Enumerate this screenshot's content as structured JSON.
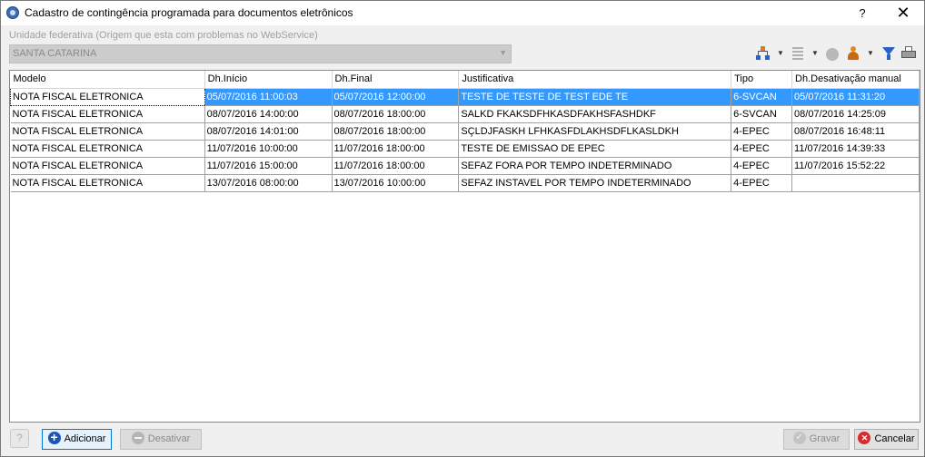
{
  "window": {
    "title": "Cadastro de contingência programada para documentos eletrônicos",
    "help_glyph": "?",
    "close_glyph": "✕"
  },
  "filter": {
    "label": "Unidade federativa (Origem que esta com problemas no WebService)",
    "value": "SANTA CATARINA"
  },
  "toolbar": {
    "icons": [
      "org-chart-icon",
      "list-view-icon",
      "circle-icon",
      "person-icon",
      "filter-icon",
      "print-icon"
    ]
  },
  "grid": {
    "columns": [
      "Modelo",
      "Dh.Início",
      "Dh.Final",
      "Justificativa",
      "Tipo",
      "Dh.Desativação manual"
    ],
    "rows": [
      [
        "NOTA FISCAL ELETRONICA",
        "05/07/2016 11:00:03",
        "05/07/2016 12:00:00",
        "TESTE DE TESTE DE TEST EDE TE",
        "6-SVCAN",
        "05/07/2016 11:31:20"
      ],
      [
        "NOTA FISCAL ELETRONICA",
        "08/07/2016 14:00:00",
        "08/07/2016 18:00:00",
        "SALKD FKAKSDFHKASDFAKHSFASHDKF",
        "6-SVCAN",
        "08/07/2016 14:25:09"
      ],
      [
        "NOTA FISCAL ELETRONICA",
        "08/07/2016 14:01:00",
        "08/07/2016 18:00:00",
        "SÇLDJFASKH LFHKASFDLAKHSDFLKASLDKH",
        "4-EPEC",
        "08/07/2016 16:48:11"
      ],
      [
        "NOTA FISCAL ELETRONICA",
        "11/07/2016 10:00:00",
        "11/07/2016 18:00:00",
        "TESTE DE EMISSAO DE EPEC",
        "4-EPEC",
        "11/07/2016 14:39:33"
      ],
      [
        "NOTA FISCAL ELETRONICA",
        "11/07/2016 15:00:00",
        "11/07/2016 18:00:00",
        "SEFAZ FORA POR TEMPO INDETERMINADO",
        "4-EPEC",
        "11/07/2016 15:52:22"
      ],
      [
        "NOTA FISCAL ELETRONICA",
        "13/07/2016 08:00:00",
        "13/07/2016 10:00:00",
        "SEFAZ INSTAVEL POR TEMPO INDETERMINADO",
        "4-EPEC",
        ""
      ]
    ],
    "selected_row": 0
  },
  "buttons": {
    "help": "?",
    "add": "Adicionar",
    "disable": "Desativar",
    "save": "Gravar",
    "cancel": "Cancelar"
  }
}
